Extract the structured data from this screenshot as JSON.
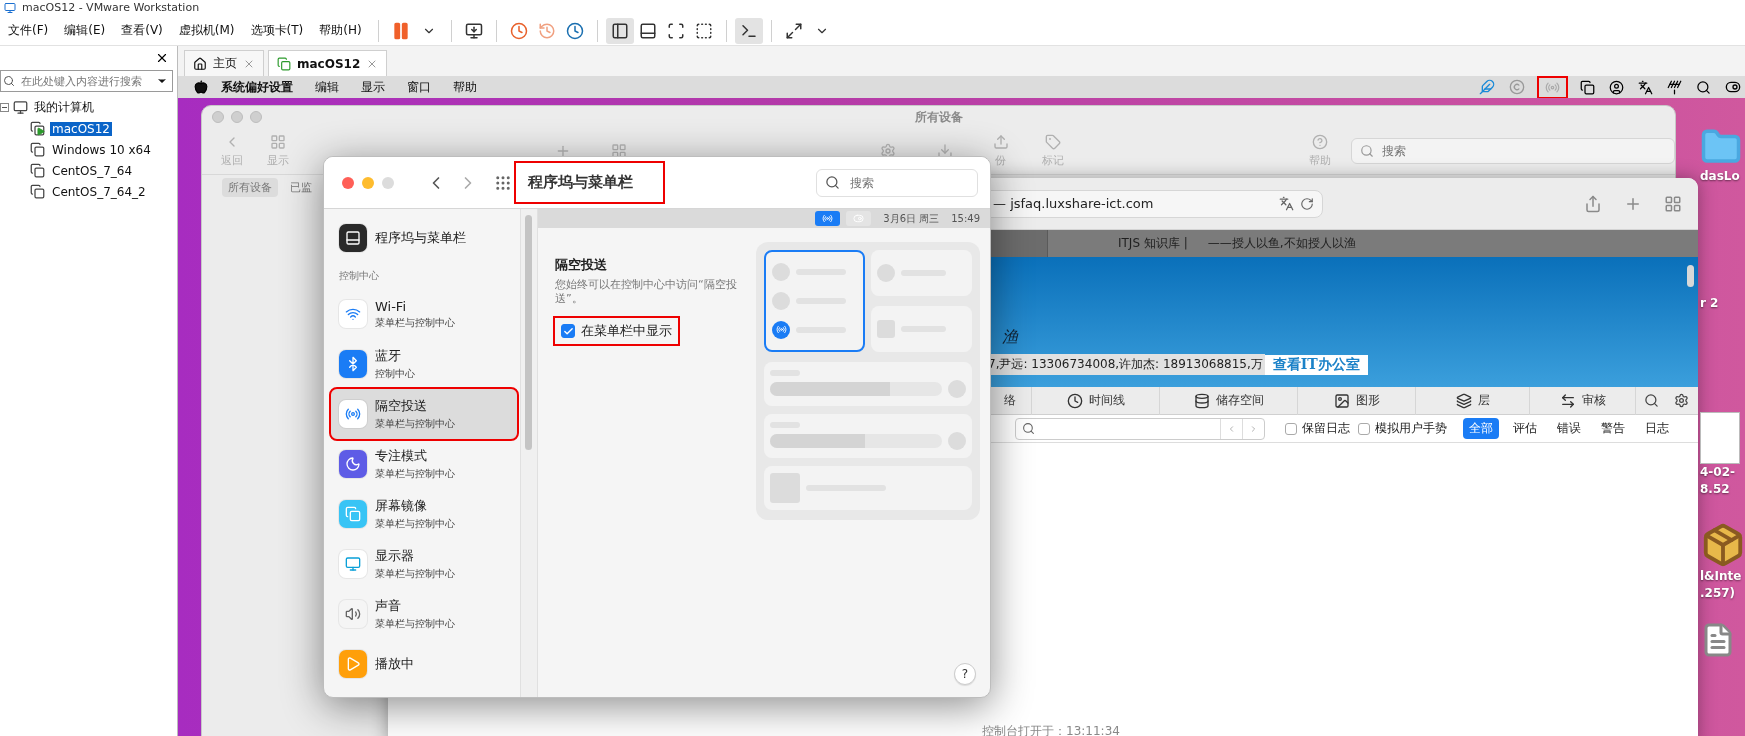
{
  "app": {
    "title": "macOS12 - VMware Workstation",
    "menu": [
      "文件(F)",
      "编辑(E)",
      "查看(V)",
      "虚拟机(M)",
      "选项卡(T)",
      "帮助(H)"
    ]
  },
  "library": {
    "search_placeholder": "在此处键入内容进行搜索",
    "tree": [
      {
        "label": "我的计算机",
        "expanded": true,
        "children": [
          {
            "label": "macOS12",
            "selected": true,
            "running": true
          },
          {
            "label": "Windows 10 x64",
            "selected": false,
            "running": false
          },
          {
            "label": "CentOS_7_64",
            "selected": false,
            "running": false
          },
          {
            "label": "CentOS_7_64_2",
            "selected": false,
            "running": false
          }
        ]
      }
    ]
  },
  "vm_tabs": [
    {
      "kind": "home",
      "label": "主页",
      "selected": false
    },
    {
      "kind": "vm",
      "label": "macOS12",
      "selected": true
    }
  ],
  "mac_menubar": {
    "items": [
      "系统偏好设置",
      "编辑",
      "显示",
      "窗口",
      "帮助"
    ],
    "airdrop_annotated": true
  },
  "prefs_window": {
    "title": "所有设备",
    "toolbar": [
      {
        "kind": "back",
        "label": "返回"
      },
      {
        "kind": "view",
        "label": "显示"
      },
      {
        "kind": "backup",
        "label": "份"
      },
      {
        "kind": "tag",
        "label": "标记"
      },
      {
        "kind": "help",
        "label": "帮助"
      }
    ],
    "search_placeholder": "搜索",
    "tabs": [
      {
        "label": "所有设备",
        "selected": true
      },
      {
        "label": "已监",
        "selected": false
      }
    ]
  },
  "browser": {
    "url": "— jsfaq.luxshare-ict.com",
    "site_title": "ITJS 知识库 |",
    "site_slogan": "——授人以鱼,不如授人以渔",
    "hero_text": "渔",
    "contacts": "7,尹远: 13306734008,许加杰: 18913068815,万",
    "contacts_link": "查看IT办公室"
  },
  "devtools": {
    "tabs": [
      {
        "kind": "network",
        "label": "络"
      },
      {
        "kind": "timeline",
        "label": "时间线"
      },
      {
        "kind": "storage",
        "label": "储存空间"
      },
      {
        "kind": "graphics",
        "label": "图形"
      },
      {
        "kind": "layers",
        "label": "层"
      },
      {
        "kind": "audit",
        "label": "审核"
      }
    ],
    "options": [
      {
        "label": "保留日志",
        "checked": false
      },
      {
        "label": "模拟用户手势",
        "checked": false
      }
    ],
    "filters": [
      {
        "label": "全部",
        "selected": true
      },
      {
        "label": "评估",
        "selected": false
      },
      {
        "label": "错误",
        "selected": false
      },
      {
        "label": "警告",
        "selected": false
      },
      {
        "label": "日志",
        "selected": false
      }
    ],
    "footer": "控制台打开于：13:11:34"
  },
  "desktop_icons": [
    {
      "kind": "folder",
      "lines": [
        "dasLo"
      ]
    },
    {
      "kind": "label",
      "lines": [
        "r 2"
      ]
    },
    {
      "kind": "screenshot",
      "lines": [
        "4-02-",
        "8.52"
      ]
    },
    {
      "kind": "package",
      "lines": [
        "l&Inte",
        ".257)"
      ]
    },
    {
      "kind": "document"
    }
  ],
  "dialog": {
    "title": "程序坞与菜单栏",
    "title_annotated": true,
    "search_placeholder": "搜索",
    "sidebar": {
      "top": {
        "kind": "dock",
        "label": "程序坞与菜单栏"
      },
      "section": "控制中心",
      "items": [
        {
          "kind": "wifi",
          "label": "Wi-Fi",
          "sub": "菜单栏与控制中心",
          "selected": false,
          "annotated": false
        },
        {
          "kind": "bluetooth",
          "label": "蓝牙",
          "sub": "控制中心",
          "selected": false,
          "annotated": false
        },
        {
          "kind": "airdrop",
          "label": "隔空投送",
          "sub": "菜单栏与控制中心",
          "selected": true,
          "annotated": true
        },
        {
          "kind": "focus",
          "label": "专注模式",
          "sub": "菜单栏与控制中心",
          "selected": false,
          "annotated": false
        },
        {
          "kind": "mirroring",
          "label": "屏幕镜像",
          "sub": "菜单栏与控制中心",
          "selected": false,
          "annotated": false
        },
        {
          "kind": "display",
          "label": "显示器",
          "sub": "菜单栏与控制中心",
          "selected": false,
          "annotated": false
        },
        {
          "kind": "sound",
          "label": "声音",
          "sub": "菜单栏与控制中心",
          "selected": false,
          "annotated": false
        },
        {
          "kind": "now_playing",
          "label": "播放中",
          "selected": false,
          "annotated": false
        }
      ]
    },
    "menubar_preview": {
      "date": "3月6日 周三",
      "time": "15:49"
    },
    "section_title": "隔空投送",
    "description": "您始终可以在控制中心中访问“隔空投送”。",
    "show_in_menubar": {
      "label": "在菜单栏中显示",
      "checked": true,
      "annotated": true
    },
    "help": "?"
  }
}
